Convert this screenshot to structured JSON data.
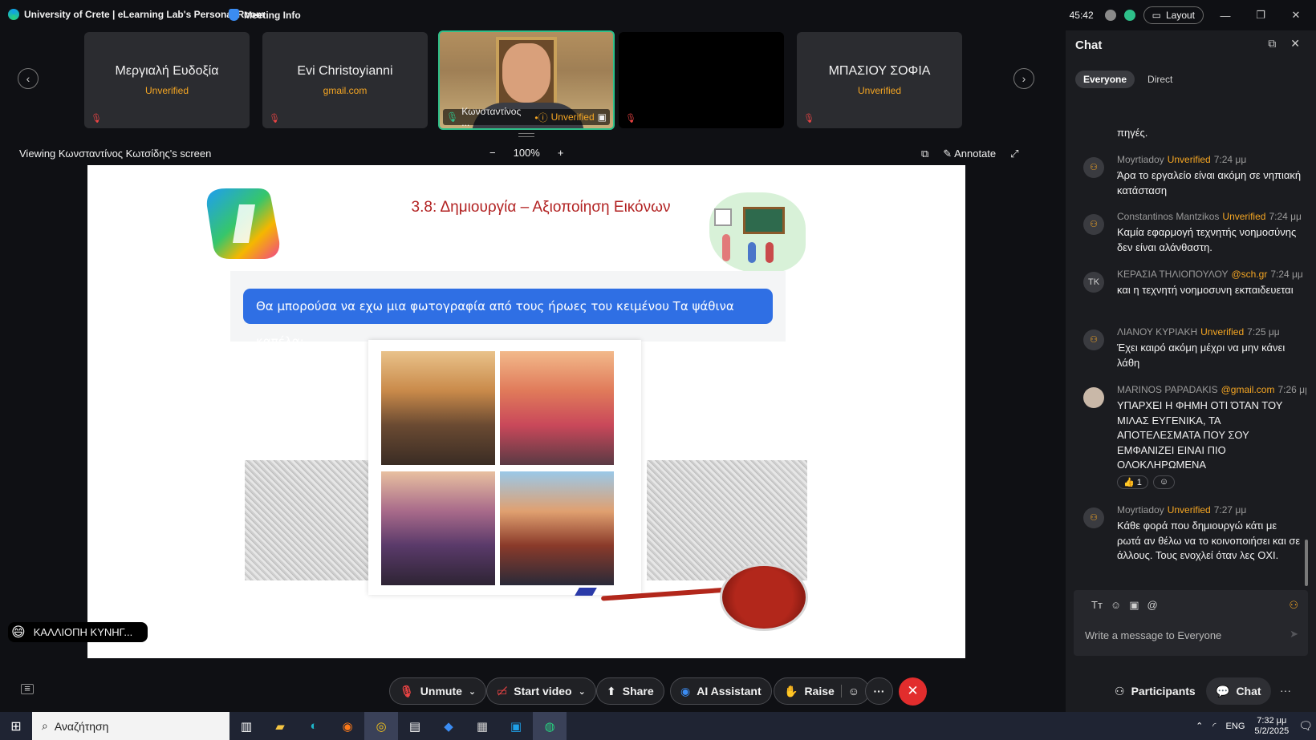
{
  "app": {
    "room_title": "University of Crete | eLearning Lab's Personal Room",
    "meeting_info": "Meeting Info",
    "timer": "45:42",
    "layout_label": "Layout",
    "accent_color": "#2ec08a",
    "warning_color": "#f5a623"
  },
  "participants_strip": [
    {
      "name": "Μεργιαλή Ευδοξία",
      "sub": "Unverified"
    },
    {
      "name": "Evi Christoyianni",
      "sub": "gmail.com"
    },
    {
      "name": "Κωνσταντίνος ...",
      "sub": "Unverified"
    },
    {
      "name": "",
      "sub": ""
    },
    {
      "name": "ΜΠΑΣΙΟΥ ΣΟΦΙΑ",
      "sub": "Unverified"
    }
  ],
  "viewer": {
    "viewing_text": "Viewing Κωνσταντίνος Κωτσίδης's screen",
    "zoom_minus": "−",
    "zoom_level": "100%",
    "zoom_plus": "+",
    "annotate_label": "Annotate"
  },
  "slide": {
    "title": "3.8: Δημιουργία – Αξιοποίηση Εικόνων",
    "prompt_text": "Θα μπορούσα να εχω μια φωτογραφία από τους ήρωες του κειμένου Τα ψάθινα καπέλα;"
  },
  "reaction_toast": {
    "emoji": "😄",
    "name": "ΚΑΛΛΙΟΠΗ ΚΥΝΗΓ..."
  },
  "chat": {
    "title": "Chat",
    "tabs": [
      {
        "label": "Everyone",
        "active": true
      },
      {
        "label": "Direct",
        "active": false
      }
    ],
    "fragment": "πηγές.",
    "messages": [
      {
        "sender": "Moyrtiadoy",
        "badge": "Unverified",
        "time": "7:24 μμ",
        "avatar": "",
        "text": "Άρα το εργαλείο είναι ακόμη σε νηπιακή κατάσταση"
      },
      {
        "sender": "Constantinos Mantzikos",
        "badge": "Unverified",
        "time": "7:24 μμ",
        "avatar": "",
        "text": "Καμία εφαρμογή τεχνητής νοημοσύνης δεν είναι αλάνθαστη."
      },
      {
        "sender": "ΚΕΡΑΣΙΑ ΤΗΛΙΟΠΟΥΛΟΥ",
        "badge": "@sch.gr",
        "time": "7:24 μμ",
        "avatar": "TK",
        "text": "και η τεχνητή νοημοσυνη εκπαιδευεται"
      },
      {
        "sender": "ΛΙΑΝΟΥ ΚΥΡΙΑΚΗ",
        "badge": "Unverified",
        "time": "7:25 μμ",
        "avatar": "",
        "text": "Έχει καιρό ακόμη μέχρι να μην κάνει λάθη"
      },
      {
        "sender": "MARINOS PAPADAKIS",
        "badge": "@gmail.com",
        "time": "7:26 μμ",
        "avatar": "",
        "text": "ΥΠΑΡΧΕΙ Η ΦΗΜΗ ΟΤΙ ΌΤΑΝ ΤΟΥ ΜΙΛΑΣ ΕΥΓΕΝΙΚΑ, ΤΑ ΑΠΟΤΕΛΕΣΜΑΤΑ ΠΟΥ ΣΟΥ ΕΜΦΑΝΙΖΕΙ ΕΙΝΑΙ ΠΙΟ ΟΛΟΚΛΗΡΩΜΕΝΑ"
      },
      {
        "sender": "Moyrtiadoy",
        "badge": "Unverified",
        "time": "7:27 μμ",
        "avatar": "",
        "text": "Κάθε φορά που δημιουργώ κάτι με ρωτά αν θέλω να το κοινοποιήσει και σε άλλους. Τους ενοχλεί όταν λες ΟΧΙ."
      }
    ],
    "reaction": {
      "emoji": "👍",
      "count": "1"
    },
    "input_placeholder": "Write a message to Everyone"
  },
  "toolbar": {
    "unmute": "Unmute",
    "start_video": "Start video",
    "share": "Share",
    "ai_assistant": "AI Assistant",
    "raise": "Raise",
    "more": "···",
    "participants": "Participants",
    "chat": "Chat",
    "overflow": "···"
  },
  "taskbar": {
    "search_placeholder": "Αναζήτηση",
    "language": "ENG",
    "time": "7:32 μμ",
    "date": "5/2/2025"
  }
}
